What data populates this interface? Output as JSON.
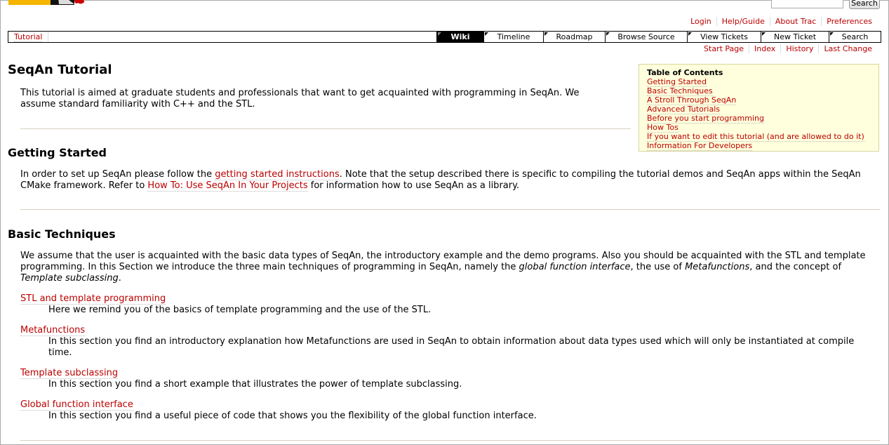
{
  "header": {
    "search_button": "Search",
    "metanav": [
      "Login",
      "Help/Guide",
      "About Trac",
      "Preferences"
    ]
  },
  "mainnav": {
    "left_link": "Tutorial",
    "tabs": [
      "Wiki",
      "Timeline",
      "Roadmap",
      "Browse Source",
      "View Tickets",
      "New Ticket",
      "Search"
    ],
    "active_tab": "Wiki"
  },
  "ctxnav": [
    "Start Page",
    "Index",
    "History",
    "Last Change"
  ],
  "page": {
    "title": "SeqAn Tutorial",
    "intro": "This tutorial is aimed at graduate students and professionals that want to get acquainted with programming in SeqAn. We assume standard familiarity with C++ and the STL.",
    "getting_started": {
      "heading": "Getting Started",
      "text_1": "In order to set up SeqAn please follow the ",
      "link_1": "getting started instructions",
      "text_2": ". Note that the setup described there is specific to compiling the tutorial demos and SeqAn apps within the SeqAn CMake framework. Refer to ",
      "link_2": "How To: Use SeqAn In Your Projects",
      "text_3": " for information how to use SeqAn as a library."
    },
    "basic_techniques": {
      "heading": "Basic Techniques",
      "text_1": "We assume that the user is acquainted with the basic data types of SeqAn, the introductory example and the demo programs. Also you should be acquainted with the STL and template programming. In this Section we introduce the three main techniques of programming in SeqAn, namely the ",
      "em_1": "global function interface",
      "text_2": ", the use of ",
      "em_2": "Metafunctions",
      "text_3": ", and the concept of ",
      "em_3": "Template subclassing",
      "text_4": ".",
      "items": [
        {
          "term": "STL and template programming",
          "desc": "Here we remind you of the basics of template programming and the use of the STL."
        },
        {
          "term": "Metafunctions",
          "desc": "In this section you find an introductory explanation how Metafunctions are used in SeqAn to obtain information about data types used which will only be instantiated at compile time."
        },
        {
          "term": "Template subclassing",
          "desc": "In this section you find a short example that illustrates the power of template subclassing."
        },
        {
          "term": "Global function interface",
          "desc": "In this section you find a useful piece of code that shows you the flexibility of the global function interface."
        }
      ]
    },
    "toc": {
      "title": "Table of Contents",
      "items": [
        "Getting Started",
        "Basic Techniques",
        "A Stroll Through SeqAn",
        "Advanced Tutorials",
        "Before you start programming",
        "How Tos",
        "If you want to edit this tutorial (and are allowed to do it)",
        "Information For Developers"
      ]
    }
  },
  "colors": {
    "link": "#bb0000",
    "toc_bg": "#ffffdd",
    "active_tab_bg": "#000000"
  }
}
